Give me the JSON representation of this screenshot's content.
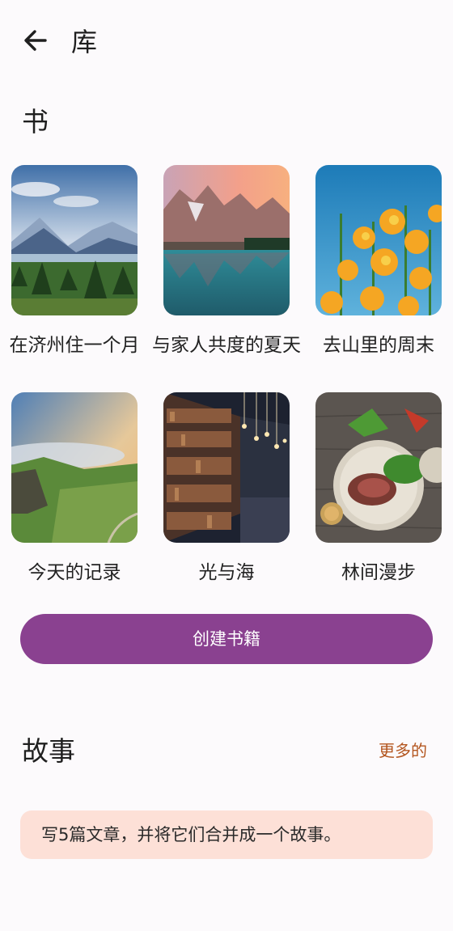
{
  "header": {
    "back_icon": "arrow-left-icon",
    "title": "库"
  },
  "books": {
    "heading": "书",
    "items": [
      {
        "title": "在济州住一个月",
        "image": "mountain-lake-forest"
      },
      {
        "title": "与家人共度的夏天",
        "image": "mountain-reflection-lake"
      },
      {
        "title": "去山里的周末",
        "image": "yellow-poppies-sky"
      },
      {
        "title": "今天的记录",
        "image": "green-hills-clouds"
      },
      {
        "title": "光与海",
        "image": "library-bookshelves"
      },
      {
        "title": "林间漫步",
        "image": "food-plate-steak-salad"
      }
    ],
    "create_button": "创建书籍"
  },
  "stories": {
    "heading": "故事",
    "more_link": "更多的",
    "prompt": "写5篇文章，并将它们合并成一个故事。"
  },
  "colors": {
    "background": "#fcfafc",
    "primary_button": "#8a4190",
    "link": "#b3551e",
    "prompt_card": "#fde0d7"
  }
}
